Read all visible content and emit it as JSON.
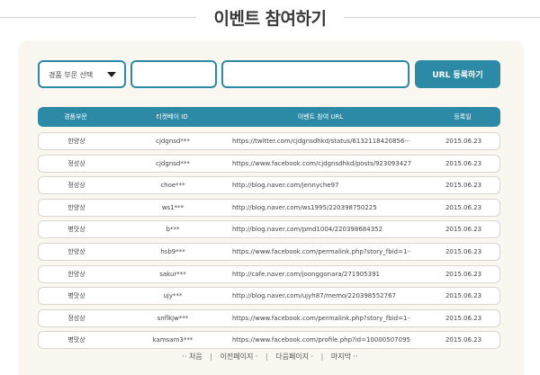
{
  "page": {
    "title": "이벤트 참여하기"
  },
  "form": {
    "category_select": {
      "selected": "경품 부문 선택"
    },
    "id_input": {
      "value": "",
      "placeholder": ""
    },
    "url_input": {
      "value": "",
      "placeholder": ""
    },
    "submit_label": "URL 등록하기"
  },
  "table": {
    "headers": [
      "경품부문",
      "티켓베이 ID",
      "이벤트 참여 URL",
      "등록일"
    ],
    "rows": [
      {
        "category": "한양상",
        "id": "cjdgnsd***",
        "url": "https://twitter.com/cjdgnsdhkd/status/6132118420856···",
        "date": "2015.06.23"
      },
      {
        "category": "정성상",
        "id": "cjdgnsd***",
        "url": "https://www.facebook.com/cjdgnsdhkd/posts/923093427···",
        "date": "2015.06.23"
      },
      {
        "category": "정성상",
        "id": "choe***",
        "url": "http://blog.naver.com/jennyche97",
        "date": "2015.06.23"
      },
      {
        "category": "한양상",
        "id": "ws1***",
        "url": "http://blog.naver.com/ws1995/220398750225",
        "date": "2015.06.23"
      },
      {
        "category": "병맛상",
        "id": "b***",
        "url": "http://blog.naver.com/pmd1004/220398684352",
        "date": "2015.06.23"
      },
      {
        "category": "한양상",
        "id": "hsb9***",
        "url": "https://www.facebook.com/permalink.php?story_fbid=1···",
        "date": "2015.06.23"
      },
      {
        "category": "한양상",
        "id": "sakur***",
        "url": "http://cafe.naver.com/joonggonara/271905391",
        "date": "2015.06.23"
      },
      {
        "category": "병맛상",
        "id": "ujy***",
        "url": "http://blog.naver.com/ujyh87/memo/220398552767",
        "date": "2015.06.23"
      },
      {
        "category": "정성상",
        "id": "snflkjw***",
        "url": "https://www.facebook.com/permalink.php?story_fbid=1···",
        "date": "2015.06.23"
      },
      {
        "category": "병맛상",
        "id": "kamsam3***",
        "url": "https://www.facebook.com/profile.php?id=10000507095···",
        "date": "2015.06.23"
      }
    ]
  },
  "pagination": {
    "first": "·· 처음",
    "prev": "이전페이지 ·",
    "next": "다음페이지 ·",
    "last": "마지막 ··",
    "separator": "|"
  },
  "colors": {
    "accent": "#2c8aa6",
    "panel_bg": "#faf6f0"
  }
}
